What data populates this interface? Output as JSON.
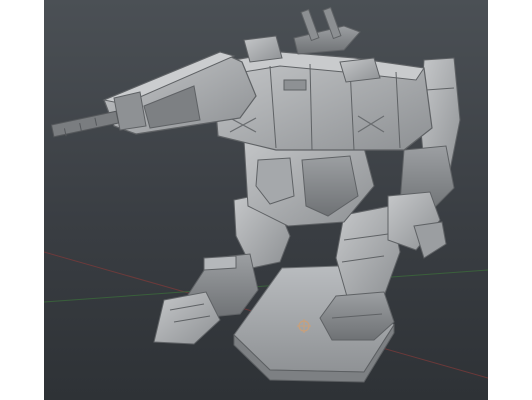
{
  "viewport": {
    "background_top": "#4b5055",
    "background_bottom": "#2e3236",
    "grid_line_x_color": "#7a3a3a",
    "grid_line_y_color": "#3b6a3b",
    "model_color": "#a7aaad",
    "pivot_icon": "manipulator-pivot-icon"
  }
}
